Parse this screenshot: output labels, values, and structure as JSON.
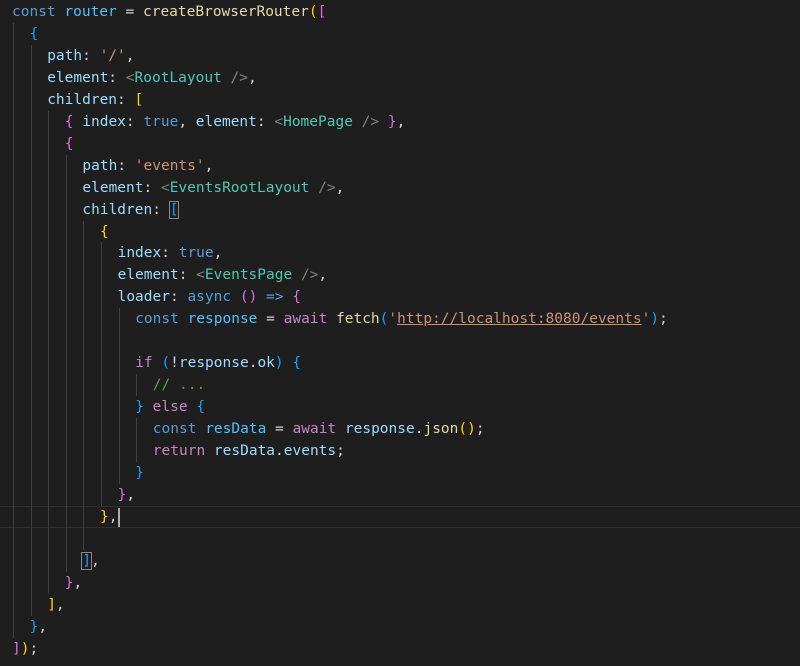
{
  "editor": {
    "language": "javascript",
    "colors": {
      "background": "#1e1e1e",
      "keyword": "#569cd6",
      "control": "#c586c0",
      "function": "#dcdcaa",
      "variable": "#9cdcfe",
      "string": "#ce9178",
      "comment": "#6a9955",
      "component": "#4ec9b0",
      "bracket_level_1": "#ffd700",
      "bracket_level_2": "#da70d6",
      "bracket_level_3": "#179fff"
    },
    "lines": [
      {
        "indent": 0,
        "tokens": [
          [
            "kw",
            "const"
          ],
          [
            "plain",
            " "
          ],
          [
            "const",
            "router"
          ],
          [
            "plain",
            " = "
          ],
          [
            "fn",
            "createBrowserRouter"
          ],
          [
            "b1",
            "("
          ],
          [
            "b2",
            "["
          ]
        ]
      },
      {
        "indent": 1,
        "tokens": [
          [
            "b3",
            "{"
          ]
        ]
      },
      {
        "indent": 2,
        "tokens": [
          [
            "prop",
            "path"
          ],
          [
            "plain",
            ": "
          ],
          [
            "str",
            "'/'"
          ],
          [
            "plain",
            ","
          ]
        ]
      },
      {
        "indent": 2,
        "tokens": [
          [
            "prop",
            "element"
          ],
          [
            "plain",
            ": "
          ],
          [
            "tagp",
            "<"
          ],
          [
            "tag",
            "RootLayout"
          ],
          [
            "plain",
            " "
          ],
          [
            "tagp",
            "/>"
          ],
          [
            "plain",
            ","
          ]
        ]
      },
      {
        "indent": 2,
        "tokens": [
          [
            "prop",
            "children"
          ],
          [
            "plain",
            ": "
          ],
          [
            "b1",
            "["
          ]
        ]
      },
      {
        "indent": 3,
        "tokens": [
          [
            "b2",
            "{"
          ],
          [
            "plain",
            " "
          ],
          [
            "prop",
            "index"
          ],
          [
            "plain",
            ": "
          ],
          [
            "bool",
            "true"
          ],
          [
            "plain",
            ", "
          ],
          [
            "prop",
            "element"
          ],
          [
            "plain",
            ": "
          ],
          [
            "tagp",
            "<"
          ],
          [
            "tag",
            "HomePage"
          ],
          [
            "plain",
            " "
          ],
          [
            "tagp",
            "/>"
          ],
          [
            "plain",
            " "
          ],
          [
            "b2",
            "}"
          ],
          [
            "plain",
            ","
          ]
        ]
      },
      {
        "indent": 3,
        "tokens": [
          [
            "b2",
            "{"
          ]
        ]
      },
      {
        "indent": 4,
        "tokens": [
          [
            "prop",
            "path"
          ],
          [
            "plain",
            ": "
          ],
          [
            "str",
            "'events'"
          ],
          [
            "plain",
            ","
          ]
        ]
      },
      {
        "indent": 4,
        "tokens": [
          [
            "prop",
            "element"
          ],
          [
            "plain",
            ": "
          ],
          [
            "tagp",
            "<"
          ],
          [
            "tag",
            "EventsRootLayout"
          ],
          [
            "plain",
            " "
          ],
          [
            "tagp",
            "/>"
          ],
          [
            "plain",
            ","
          ]
        ]
      },
      {
        "indent": 4,
        "tokens": [
          [
            "prop",
            "children"
          ],
          [
            "plain",
            ": "
          ],
          [
            "b3box",
            "["
          ]
        ]
      },
      {
        "indent": 5,
        "tokens": [
          [
            "b1",
            "{"
          ]
        ]
      },
      {
        "indent": 6,
        "tokens": [
          [
            "prop",
            "index"
          ],
          [
            "plain",
            ": "
          ],
          [
            "bool",
            "true"
          ],
          [
            "plain",
            ","
          ]
        ]
      },
      {
        "indent": 6,
        "tokens": [
          [
            "prop",
            "element"
          ],
          [
            "plain",
            ": "
          ],
          [
            "tagp",
            "<"
          ],
          [
            "tag",
            "EventsPage"
          ],
          [
            "plain",
            " "
          ],
          [
            "tagp",
            "/>"
          ],
          [
            "plain",
            ","
          ]
        ]
      },
      {
        "indent": 6,
        "tokens": [
          [
            "prop",
            "loader"
          ],
          [
            "plain",
            ": "
          ],
          [
            "kw",
            "async"
          ],
          [
            "plain",
            " "
          ],
          [
            "b2",
            "()"
          ],
          [
            "plain",
            " "
          ],
          [
            "kw",
            "=>"
          ],
          [
            "plain",
            " "
          ],
          [
            "b2",
            "{"
          ]
        ]
      },
      {
        "indent": 7,
        "tokens": [
          [
            "kw",
            "const"
          ],
          [
            "plain",
            " "
          ],
          [
            "const",
            "response"
          ],
          [
            "plain",
            " = "
          ],
          [
            "ctl",
            "await"
          ],
          [
            "plain",
            " "
          ],
          [
            "fn",
            "fetch"
          ],
          [
            "b3",
            "("
          ],
          [
            "str",
            "'"
          ],
          [
            "url",
            "http://localhost:8080/events"
          ],
          [
            "str",
            "'"
          ],
          [
            "b3",
            ")"
          ],
          [
            "plain",
            ";"
          ]
        ]
      },
      {
        "indent": 7,
        "tokens": []
      },
      {
        "indent": 7,
        "tokens": [
          [
            "ctl",
            "if"
          ],
          [
            "plain",
            " "
          ],
          [
            "b3",
            "("
          ],
          [
            "plain",
            "!"
          ],
          [
            "var",
            "response"
          ],
          [
            "plain",
            "."
          ],
          [
            "var",
            "ok"
          ],
          [
            "b3",
            ")"
          ],
          [
            "plain",
            " "
          ],
          [
            "b3",
            "{"
          ]
        ]
      },
      {
        "indent": 8,
        "tokens": [
          [
            "cmt",
            "// ..."
          ]
        ]
      },
      {
        "indent": 7,
        "tokens": [
          [
            "b3",
            "}"
          ],
          [
            "plain",
            " "
          ],
          [
            "ctl",
            "else"
          ],
          [
            "plain",
            " "
          ],
          [
            "b3",
            "{"
          ]
        ]
      },
      {
        "indent": 8,
        "tokens": [
          [
            "kw",
            "const"
          ],
          [
            "plain",
            " "
          ],
          [
            "const",
            "resData"
          ],
          [
            "plain",
            " = "
          ],
          [
            "ctl",
            "await"
          ],
          [
            "plain",
            " "
          ],
          [
            "var",
            "response"
          ],
          [
            "plain",
            "."
          ],
          [
            "fn",
            "json"
          ],
          [
            "b1",
            "()"
          ],
          [
            "plain",
            ";"
          ]
        ]
      },
      {
        "indent": 8,
        "tokens": [
          [
            "ctl",
            "return"
          ],
          [
            "plain",
            " "
          ],
          [
            "var",
            "resData"
          ],
          [
            "plain",
            "."
          ],
          [
            "var",
            "events"
          ],
          [
            "plain",
            ";"
          ]
        ]
      },
      {
        "indent": 7,
        "tokens": [
          [
            "b3",
            "}"
          ]
        ]
      },
      {
        "indent": 6,
        "tokens": [
          [
            "b2",
            "}"
          ],
          [
            "plain",
            ","
          ]
        ]
      },
      {
        "indent": 5,
        "tokens": [
          [
            "b1",
            "}"
          ],
          [
            "plain",
            ","
          ]
        ],
        "current": true
      },
      {
        "indent": 5,
        "tokens": []
      },
      {
        "indent": 4,
        "tokens": [
          [
            "b3box",
            "]"
          ],
          [
            "plain",
            ","
          ]
        ]
      },
      {
        "indent": 3,
        "tokens": [
          [
            "b2",
            "}"
          ],
          [
            "plain",
            ","
          ]
        ]
      },
      {
        "indent": 2,
        "tokens": [
          [
            "b1",
            "]"
          ],
          [
            "plain",
            ","
          ]
        ]
      },
      {
        "indent": 1,
        "tokens": [
          [
            "b3",
            "}"
          ],
          [
            "plain",
            ","
          ]
        ]
      },
      {
        "indent": 0,
        "tokens": [
          [
            "b2",
            "]"
          ],
          [
            "b1",
            ")"
          ],
          [
            "plain",
            ";"
          ]
        ]
      }
    ]
  }
}
